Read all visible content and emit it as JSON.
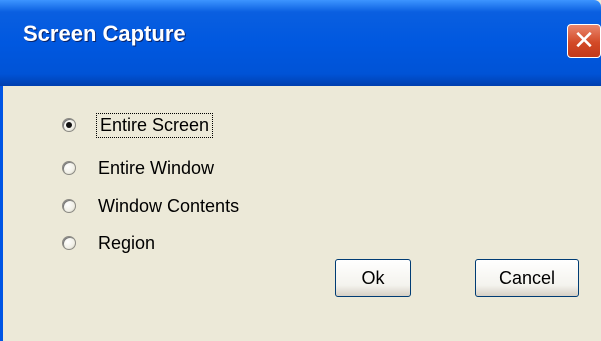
{
  "window": {
    "title": "Screen Capture",
    "close_symbol": "✕"
  },
  "options": [
    {
      "label": "Entire Screen",
      "selected": true
    },
    {
      "label": "Entire Window",
      "selected": false
    },
    {
      "label": "Window Contents",
      "selected": false
    },
    {
      "label": "Region",
      "selected": false
    }
  ],
  "buttons": {
    "ok_label": "Ok",
    "cancel_label": "Cancel"
  }
}
